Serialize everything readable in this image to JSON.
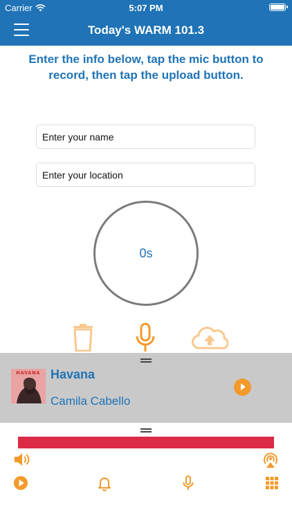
{
  "status_bar": {
    "carrier": "Carrier",
    "time": "5:07 PM"
  },
  "nav": {
    "title": "Today's WARM 101.3"
  },
  "instructions": "Enter the info below, tap the mic button to record, then tap the upload button.",
  "form": {
    "name_placeholder": "Enter your name",
    "location_placeholder": "Enter your location"
  },
  "recorder": {
    "elapsed": "0s"
  },
  "now_playing": {
    "title": "Havana",
    "artist": "Camila Cabello",
    "album_art_text": "HAVANA"
  },
  "colors": {
    "brand_blue": "#1f73b6",
    "accent_orange": "#f39a2b",
    "accent_orange_light": "#f8c88e",
    "player_bg": "#c9c9c9",
    "progress_red": "#dc2b44"
  },
  "icons": {
    "record_controls": [
      "trash-icon",
      "microphone-icon",
      "cloud-upload-icon"
    ],
    "player_controls": [
      "speaker-icon",
      "broadcast-icon"
    ],
    "tabs": [
      "play-circle-icon",
      "bell-icon",
      "microphone-icon",
      "grid-icon"
    ]
  }
}
